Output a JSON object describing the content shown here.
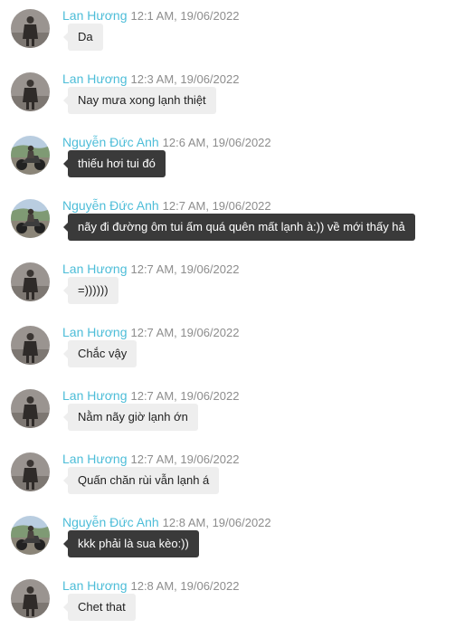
{
  "messages": [
    {
      "sender": "Lan Hương",
      "time": "12:1 AM, 19/06/2022",
      "text": "Da",
      "style": "light",
      "avatar": "avatar-lan-huong"
    },
    {
      "sender": "Lan Hương",
      "time": "12:3 AM, 19/06/2022",
      "text": "Nay mưa xong lạnh thiệt",
      "style": "light",
      "avatar": "avatar-lan-huong"
    },
    {
      "sender": "Nguyễn Đức Anh",
      "time": "12:6 AM, 19/06/2022",
      "text": "thiếu hơi tui đó",
      "style": "dark",
      "avatar": "avatar-nguyen-duc-anh"
    },
    {
      "sender": "Nguyễn Đức Anh",
      "time": "12:7 AM, 19/06/2022",
      "text": "nãy đi đường ôm tui ấm quá quên mất lạnh à:))  về mới thấy hả",
      "style": "dark",
      "avatar": "avatar-nguyen-duc-anh"
    },
    {
      "sender": "Lan Hương",
      "time": "12:7 AM, 19/06/2022",
      "text": "=))))))",
      "style": "light",
      "avatar": "avatar-lan-huong"
    },
    {
      "sender": "Lan Hương",
      "time": "12:7 AM, 19/06/2022",
      "text": "Chắc vậy",
      "style": "light",
      "avatar": "avatar-lan-huong"
    },
    {
      "sender": "Lan Hương",
      "time": "12:7 AM, 19/06/2022",
      "text": "Nằm nãy giờ lạnh ớn",
      "style": "light",
      "avatar": "avatar-lan-huong"
    },
    {
      "sender": "Lan Hương",
      "time": "12:7 AM, 19/06/2022",
      "text": "Quấn chăn rùi vẫn lạnh á",
      "style": "light",
      "avatar": "avatar-lan-huong"
    },
    {
      "sender": "Nguyễn Đức Anh",
      "time": "12:8 AM, 19/06/2022",
      "text": "kkk phải là sua kèo:))",
      "style": "dark",
      "avatar": "avatar-nguyen-duc-anh"
    },
    {
      "sender": "Lan Hương",
      "time": "12:8 AM, 19/06/2022",
      "text": "Chet that",
      "style": "light",
      "avatar": "avatar-lan-huong"
    }
  ],
  "colors": {
    "sender": "#4dbdd8",
    "time": "#8d8d8d",
    "bubble_light": "#eeeeee",
    "bubble_dark": "#3a3a3a"
  }
}
